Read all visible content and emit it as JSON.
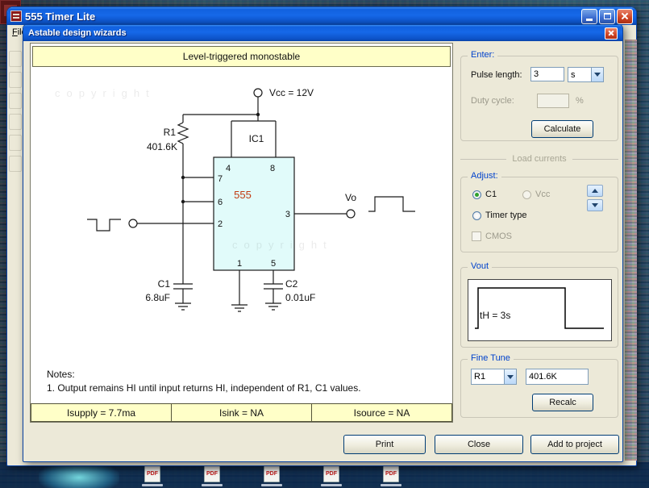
{
  "desktop": {
    "pdf_icon_label": "PDF"
  },
  "window": {
    "title": "555 Timer Lite",
    "menu_file": "File"
  },
  "dialog": {
    "title": "Astable design wizards"
  },
  "colors": {
    "titlebar_blue": "#1464E0",
    "dialog_bg": "#ECE9D8",
    "panel_cream": "#FFFFC8",
    "chip_fill": "#E1FBFA",
    "chip_text_red": "#C23A10",
    "group_title_blue": "#0042CC"
  },
  "schematic": {
    "header": "Level-triggered monostable",
    "watermark": "copyright",
    "vcc_label": "Vcc = 12V",
    "ic_ref": "IC1",
    "chip_label": "555",
    "pins": {
      "p1": "1",
      "p2": "2",
      "p3": "3",
      "p4": "4",
      "p5": "5",
      "p6": "6",
      "p7": "7",
      "p8": "8"
    },
    "r1_name": "R1",
    "r1_value": "401.6K",
    "c1_name": "C1",
    "c1_value": "6.8uF",
    "c2_name": "C2",
    "c2_value": "0.01uF",
    "vo_label": "Vo",
    "notes_title": "Notes:",
    "note_1": "1. Output remains HI until input returns HI, independent of R1, C1 values.",
    "status": [
      "Isupply = 7.7ma",
      "Isink = NA",
      "Isource = NA"
    ]
  },
  "enter_group": {
    "title": "Enter:",
    "pulse_length_label": "Pulse length:",
    "pulse_length_value": "3",
    "unit_value": "s",
    "duty_cycle_label": "Duty cycle:",
    "duty_cycle_value": "",
    "percent_label": "%",
    "calculate_label": "Calculate"
  },
  "load_currents_label": "Load currents",
  "adjust_group": {
    "title": "Adjust:",
    "radio_c1_label": "C1",
    "radio_vcc_label": "Vcc",
    "radio_timer_label": "Timer type",
    "cmos_label": "CMOS"
  },
  "vout_group": {
    "title": "Vout",
    "annotation": "tH = 3s"
  },
  "fine_tune_group": {
    "title": "Fine Tune",
    "component_value": "R1",
    "value_field": "401.6K",
    "recalc_label": "Recalc"
  },
  "footer": {
    "print_label": "Print",
    "close_label": "Close",
    "add_label": "Add to project"
  }
}
